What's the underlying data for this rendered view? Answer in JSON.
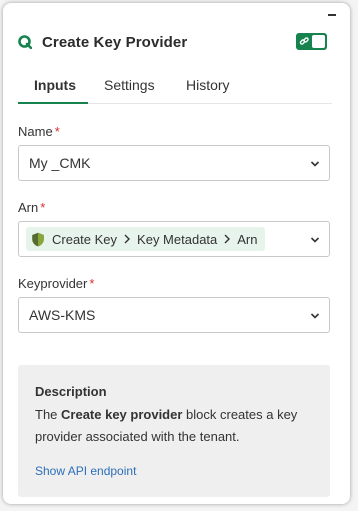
{
  "header": {
    "title": "Create Key Provider"
  },
  "tabs": [
    {
      "label": "Inputs",
      "active": true
    },
    {
      "label": "Settings",
      "active": false
    },
    {
      "label": "History",
      "active": false
    }
  ],
  "fields": {
    "name": {
      "label": "Name",
      "required": "*",
      "value": "My _CMK"
    },
    "arn": {
      "label": "Arn",
      "required": "*",
      "path": [
        "Create Key",
        "Key Metadata",
        "Arn"
      ]
    },
    "keyprovider": {
      "label": "Keyprovider",
      "required": "*",
      "value": "AWS-KMS"
    }
  },
  "description": {
    "title": "Description",
    "text_before": "The ",
    "text_bold": "Create key provider",
    "text_after": " block creates a key provider associated with the tenant.",
    "link": "Show API endpoint"
  },
  "colors": {
    "accent": "#16824d",
    "link": "#2d6fb8",
    "required": "#d32f2f"
  },
  "icons": [
    "app-logo-icon",
    "link-icon",
    "chevron-down-icon",
    "shield-icon",
    "chevron-right-icon",
    "minimize-icon"
  ]
}
